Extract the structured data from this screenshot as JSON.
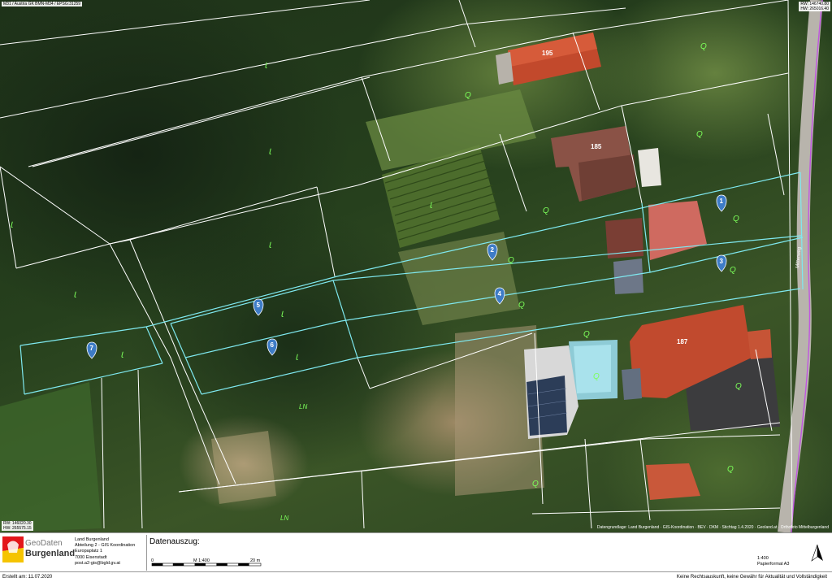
{
  "map": {
    "coord_top_left": "M31 / Austria GK BMN-M34 / EPSG:31259",
    "coord_top_right_1": "RW: 146740.80",
    "coord_top_right_2": "HW: 265016.40",
    "coord_bottom_left_1": "RW: 146020.30",
    "coord_bottom_left_2": "HW: 265575.15",
    "attribution": "Datengrundlage: Land Burgenland · GIS-Koordination · BEV · DKM · Stichtag 1.4.2020 · Geoland.at · Orthofoto Mittelburgenland",
    "street_name": "Mitterweg",
    "house_numbers": [
      "195",
      "185",
      "187"
    ],
    "land_use_symbols": [
      "Ꙇ",
      "Q",
      "LN"
    ],
    "parcel_markers": [
      "1",
      "2",
      "3",
      "4",
      "5",
      "6",
      "7"
    ],
    "colors": {
      "parcel_boundary": "#ffffff",
      "highlight_boundary": "#7fe9f0",
      "municipal_boundary": "#c056e0",
      "marker": "#3e7cc6",
      "symbol": "#7cff5a",
      "roof": "#b8482e"
    }
  },
  "footer": {
    "logo_geo": "GeoDaten",
    "logo_name": "Burgenland",
    "address_lines": [
      "Land Burgenland",
      "Abteilung 2 - GIS Koordination",
      "Europaplatz 1",
      "7000 Eisenstadt",
      "post.a2-gis@bgld.gv.at"
    ],
    "extract_title": "Datenauszug:",
    "scale_zero": "0",
    "scale_label": "M 1:400",
    "scale_end": "20 m",
    "scale_ratio": "1:400",
    "paper_format": "Papierformat A3",
    "north_icon": "north-arrow-icon",
    "created": "Erstellt am: 11.07.2020",
    "disclaimer": "Keine Rechtsauskunft, keine Gewähr für Aktualität und Vollständigkeit"
  }
}
